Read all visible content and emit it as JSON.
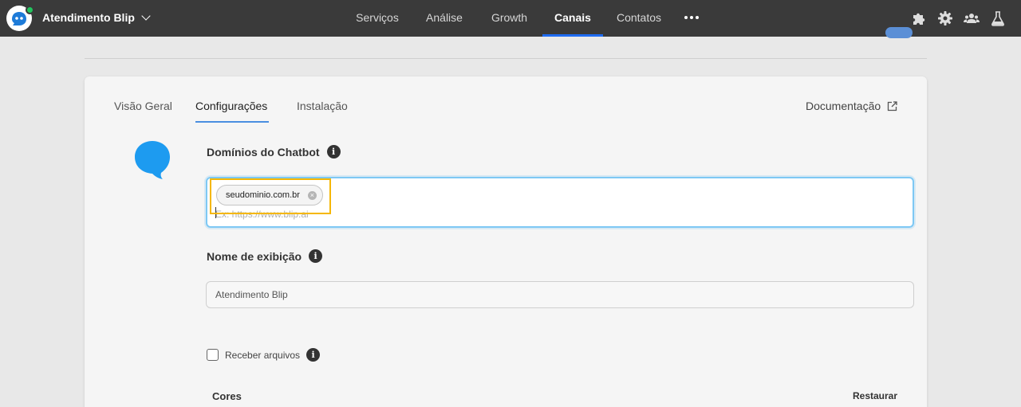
{
  "app": {
    "name": "Atendimento Blip"
  },
  "nav": {
    "items": [
      {
        "label": "Serviços",
        "active": false
      },
      {
        "label": "Análise",
        "active": false
      },
      {
        "label": "Growth",
        "active": false
      },
      {
        "label": "Canais",
        "active": true
      },
      {
        "label": "Contatos",
        "active": false
      }
    ]
  },
  "top_icons": [
    "puzzle-icon",
    "gear-icon",
    "users-icon",
    "flask-icon"
  ],
  "colors": {
    "topbar": "#3a3a3a",
    "accent": "#1e6bf1",
    "bubble": "#1d9bf0",
    "highlight": "#f5b700",
    "focus": "#7ec8f4"
  },
  "tabs": [
    {
      "label": "Visão Geral",
      "active": false
    },
    {
      "label": "Configurações",
      "active": true
    },
    {
      "label": "Instalação",
      "active": false
    }
  ],
  "doc_link": "Documentação",
  "domains": {
    "label": "Domínios do Chatbot",
    "chip": "seudominio.com.br",
    "placeholder": "Ex: https://www.blip.ai"
  },
  "display_name": {
    "label": "Nome de exibição",
    "value": "Atendimento Blip"
  },
  "receive_files": {
    "label": "Receber arquivos",
    "checked": false
  },
  "colors_section": {
    "label": "Cores",
    "reset": "Restaurar"
  }
}
